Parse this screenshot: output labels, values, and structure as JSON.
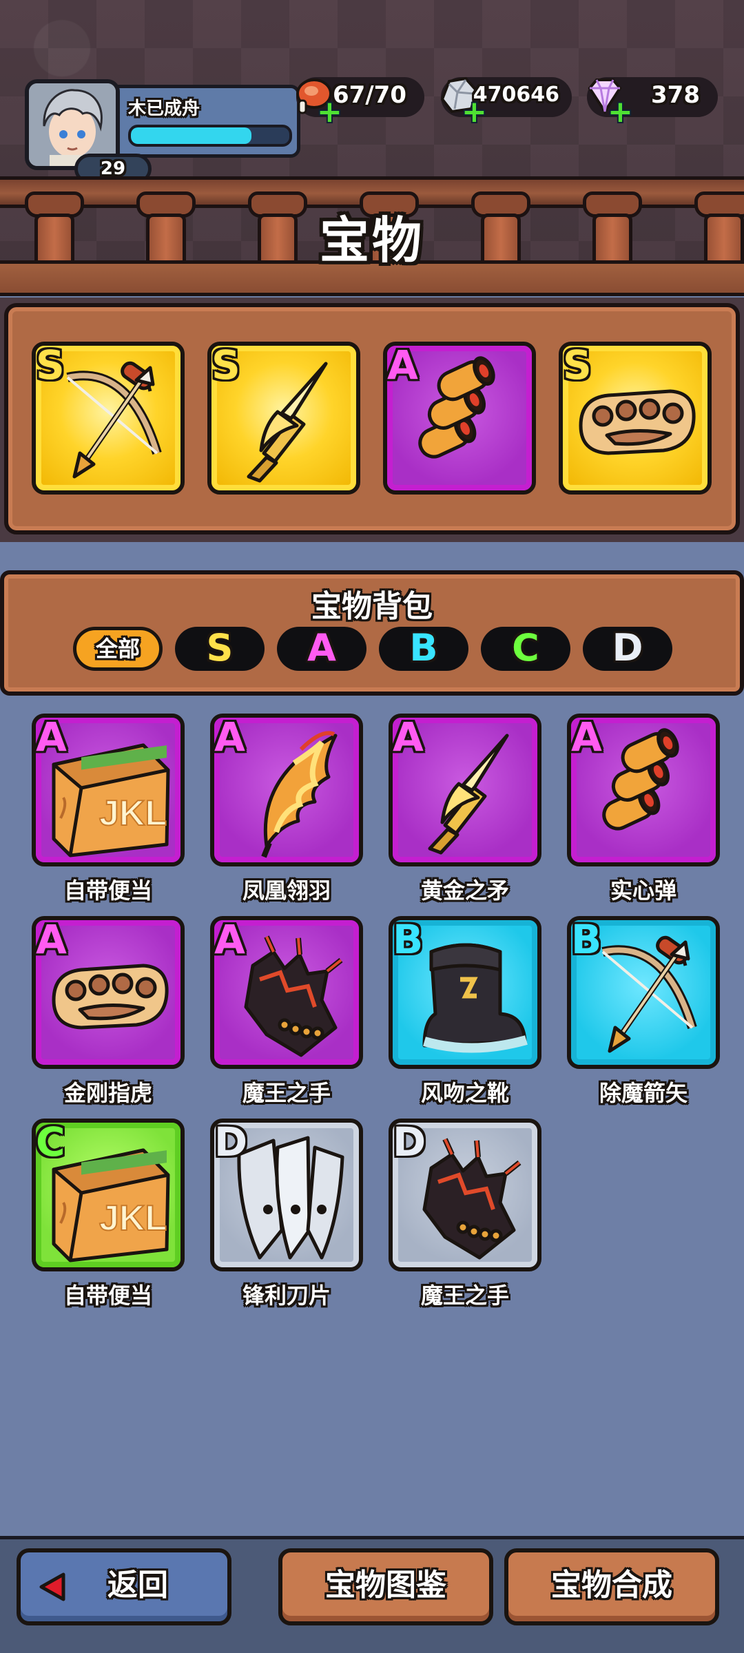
{
  "player": {
    "name": "木已成舟",
    "level": "29",
    "exp_fraction": 0.76
  },
  "currency": {
    "energy": "67/70",
    "silver": "470646",
    "gems": "378"
  },
  "page_title": "宝物",
  "equipped": [
    {
      "grade": "S",
      "icon": "bow-arrow-icon"
    },
    {
      "grade": "S",
      "icon": "golden-spear-icon"
    },
    {
      "grade": "A",
      "icon": "bullets-icon"
    },
    {
      "grade": "S",
      "icon": "brass-knuckles-icon"
    }
  ],
  "bag": {
    "title": "宝物背包",
    "filters": [
      "全部",
      "S",
      "A",
      "B",
      "C",
      "D"
    ],
    "filter_colors": {
      "S": "#ffe14a",
      "A": "#ff5bf1",
      "B": "#39e4ff",
      "C": "#6dff3e",
      "D": "#e9eef6"
    },
    "items": [
      {
        "grade": "A",
        "name": "自带便当",
        "icon": "lunchbox-icon"
      },
      {
        "grade": "A",
        "name": "凤凰翎羽",
        "icon": "phoenix-feather-icon"
      },
      {
        "grade": "A",
        "name": "黄金之矛",
        "icon": "golden-spear-icon"
      },
      {
        "grade": "A",
        "name": "实心弹",
        "icon": "bullets-icon"
      },
      {
        "grade": "A",
        "name": "金刚指虎",
        "icon": "brass-knuckles-icon"
      },
      {
        "grade": "A",
        "name": "魔王之手",
        "icon": "demon-gauntlet-icon"
      },
      {
        "grade": "B",
        "name": "风吻之靴",
        "icon": "boot-icon"
      },
      {
        "grade": "B",
        "name": "除魔箭矢",
        "icon": "bow-arrow-icon"
      },
      {
        "grade": "C",
        "name": "自带便当",
        "icon": "lunchbox-icon"
      },
      {
        "grade": "D",
        "name": "锋利刀片",
        "icon": "blades-icon"
      },
      {
        "grade": "D",
        "name": "魔王之手",
        "icon": "demon-gauntlet-icon"
      }
    ],
    "lunchbox_text": "JKL"
  },
  "buttons": {
    "back": "返回",
    "atlas": "宝物图鉴",
    "synthesize": "宝物合成"
  }
}
